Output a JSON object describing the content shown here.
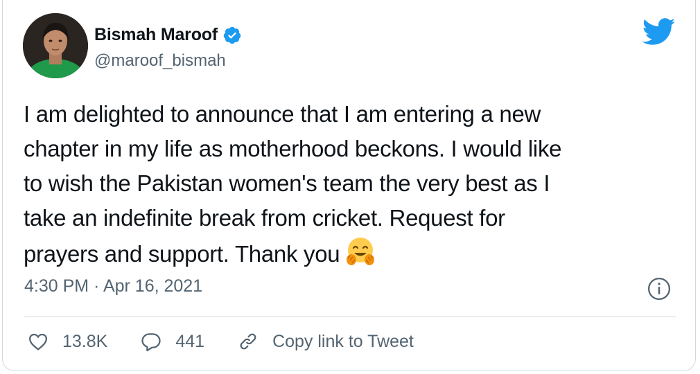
{
  "author": {
    "name": "Bismah Maroof",
    "handle": "@maroof_bismah",
    "verified": true
  },
  "tweet": {
    "lines": [
      "I am delighted to announce that I am entering a new",
      "chapter in my life as motherhood beckons. I would like",
      "to wish the Pakistan women's team the very best as I",
      "take an indefinite break from cricket. Request for",
      "prayers and support. Thank you"
    ],
    "emoji": "hugging-face-emoji",
    "time": "4:30 PM · Apr 16, 2021"
  },
  "actions": {
    "likes": "13.8K",
    "replies": "441",
    "copy_link": "Copy link to Tweet"
  },
  "colors": {
    "brand": "#1d9bf0",
    "text": "#0f1419",
    "secondary": "#536471",
    "border": "#cfd9de"
  },
  "icons": [
    "twitter-bird-icon",
    "verified-badge-icon",
    "info-icon",
    "heart-icon",
    "reply-bubble-icon",
    "link-icon"
  ]
}
